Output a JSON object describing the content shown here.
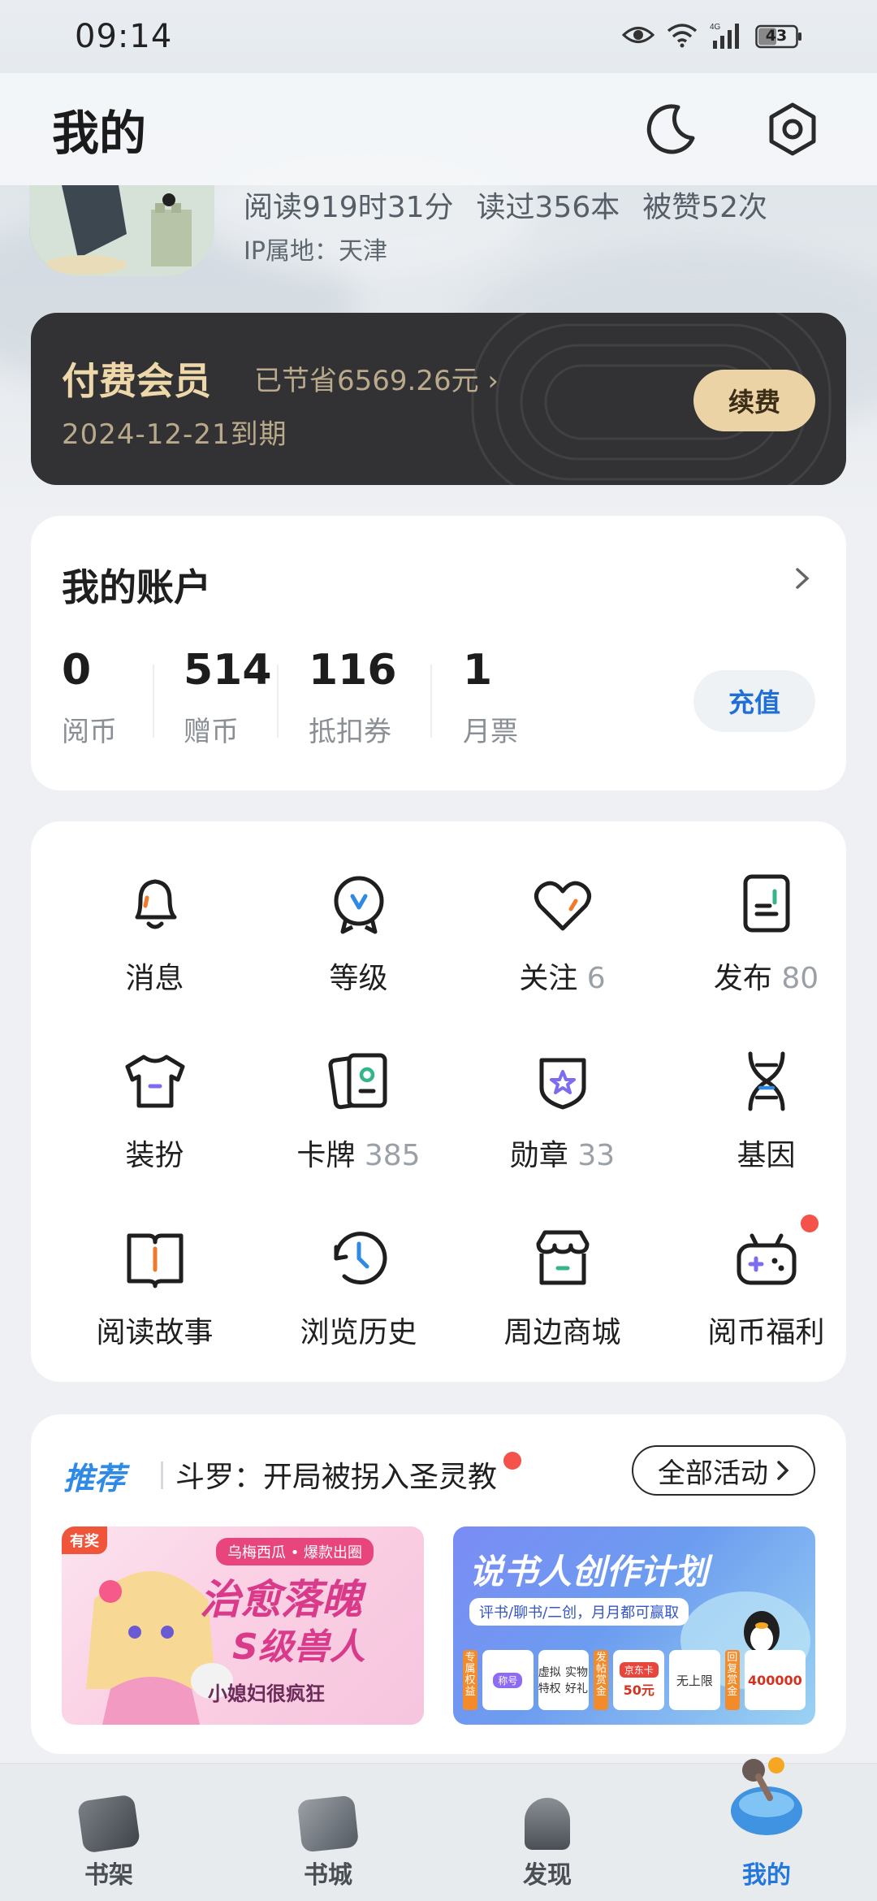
{
  "status_bar": {
    "time": "09:14",
    "battery": "43"
  },
  "header": {
    "title": "我的",
    "theme_icon": "moon-icon",
    "settings_icon": "settings-hex-icon"
  },
  "profile": {
    "read_time": "阅读919时31分",
    "books_read": "读过356本",
    "likes": "被赞52次",
    "ip_location": "IP属地：天津"
  },
  "vip": {
    "title": "付费会员",
    "saved": "已节省6569.26元 ›",
    "expiry": "2024-12-21到期",
    "renew_label": "续费"
  },
  "account": {
    "title": "我的账户",
    "metrics": [
      {
        "value": "0",
        "label": "阅币"
      },
      {
        "value": "514",
        "label": "赠币"
      },
      {
        "value": "116",
        "label": "抵扣券"
      },
      {
        "value": "1",
        "label": "月票"
      }
    ],
    "recharge_label": "充值"
  },
  "features": [
    {
      "label": "消息",
      "count": "",
      "icon": "bell-icon"
    },
    {
      "label": "等级",
      "count": "",
      "icon": "level-badge-icon"
    },
    {
      "label": "关注",
      "count": "6",
      "icon": "heart-icon"
    },
    {
      "label": "发布",
      "count": "80",
      "icon": "document-icon"
    },
    {
      "label": "装扮",
      "count": "",
      "icon": "tshirt-icon"
    },
    {
      "label": "卡牌",
      "count": "385",
      "icon": "cards-icon"
    },
    {
      "label": "勋章",
      "count": "33",
      "icon": "medal-icon"
    },
    {
      "label": "基因",
      "count": "",
      "icon": "dna-icon"
    },
    {
      "label": "阅读故事",
      "count": "",
      "icon": "open-book-icon"
    },
    {
      "label": "浏览历史",
      "count": "",
      "icon": "history-clock-icon"
    },
    {
      "label": "周边商城",
      "count": "",
      "icon": "shop-icon"
    },
    {
      "label": "阅币福利",
      "count": "",
      "icon": "gamepad-icon"
    }
  ],
  "recommend": {
    "tag": "推荐",
    "headline": "斗罗：开局被拐入圣灵教",
    "all_label": "全部活动",
    "banner1": {
      "badge": "有奖",
      "top": "乌梅西瓜 • 爆款出圈",
      "main": "治愈落魄",
      "main2": "S级兽人",
      "sub": "小媳妇很疯狂"
    },
    "banner2": {
      "title": "说书人创作计划",
      "sub": "评书/聊书/二创，月月都可赢取",
      "items": [
        "专属权益",
        "称号",
        "虚拟特权",
        "实物好礼",
        "发帖赏金",
        "京东卡",
        "50元",
        "无上限",
        "回复赏金",
        "400000"
      ]
    }
  },
  "bottom_nav": [
    {
      "label": "书架",
      "active": false
    },
    {
      "label": "书城",
      "active": false
    },
    {
      "label": "发现",
      "active": false
    },
    {
      "label": "我的",
      "active": true
    }
  ],
  "colors": {
    "accent": "#2277dd",
    "vip_gold": "#eed7a8",
    "vip_bg": "#323234",
    "red_dot": "#f4524a"
  }
}
